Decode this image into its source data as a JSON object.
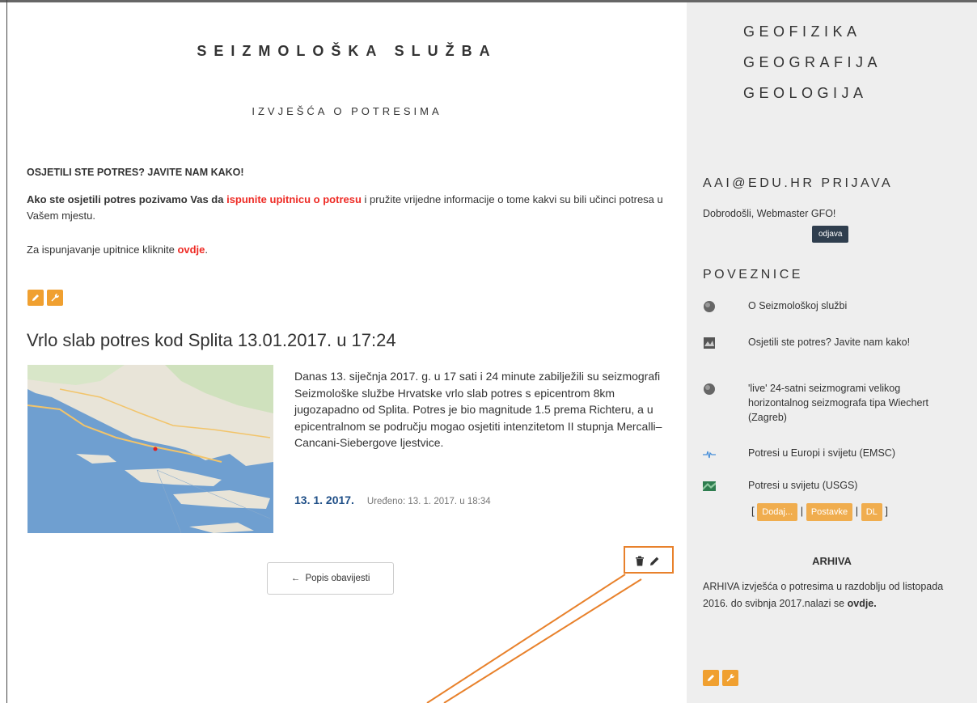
{
  "main": {
    "site_title": "SEIZMOLOŠKA SLUŽBA",
    "section_title": "IZVJEŠĆA O POTRESIMA",
    "felt": {
      "heading": "OSJETILI STE POTRES? JAVITE NAM KAKO!",
      "text_a": "Ako ste osjetili potres pozivamo Vas da ",
      "text_link": "ispunite upitnicu o potresu",
      "text_b": " i pružite vrijedne informacije o tome kakvi su bili učinci potresa u Vašem mjestu.",
      "text2_a": "Za ispunjavanje upitnice kliknite ",
      "text2_link": "ovdje",
      "text2_b": "."
    },
    "article": {
      "title": "Vrlo slab potres kod Splita 13.01.2017. u 17:24",
      "body": "Danas 13. siječnja 2017. g. u 17 sati i 24 minute zabilježili su seizmografi Seizmološke službe Hrvatske vrlo slab potres s epicentrom 8km jugozapadno od Splita. Potres je bio magnitude 1.5 prema Richteru, a u epicentralnom se području mogao osjetiti intenzitetom II stupnja Mercalli–Cancani-Siebergove ljestvice.",
      "date": "13. 1. 2017.",
      "edited": "Uređeno: 13. 1. 2017. u 18:34"
    },
    "back_button": "Popis obavijesti"
  },
  "sidebar": {
    "departments": [
      "GEOFIZIKA",
      "GEOGRAFIJA",
      "GEOLOGIJA"
    ],
    "login_heading": "AAI@EDU.HR PRIJAVA",
    "welcome": "Dobrodošli, Webmaster GFO!",
    "logout": "odjava",
    "links_heading": "POVEZNICE",
    "links": [
      {
        "label": "O Seizmološkoj službi",
        "icon": "globe-icon"
      },
      {
        "label": "Osjetili ste potres? Javite nam kako!",
        "icon": "image-icon"
      },
      {
        "label": "'live' 24-satni seizmogrami velikog horizontalnog seizmografa tipa Wiechert (Zagreb)",
        "icon": "globe-icon"
      },
      {
        "label": "Potresi u Europi i svijetu (EMSC)",
        "icon": "seismogram-icon"
      },
      {
        "label": "Potresi u svijetu (USGS)",
        "icon": "usgs-icon"
      }
    ],
    "link_controls": {
      "open": "[",
      "sep": "|",
      "close": "]",
      "add": "Dodaj...",
      "settings": "Postavke",
      "dl": "DL"
    },
    "archive_heading": "ARHIVA",
    "archive_text_a": "ARHIVA izvješća o potresima u razdoblju od listopada 2016. do svibnja 2017.nalazi se ",
    "archive_link": "ovdje",
    "archive_text_b": "."
  },
  "colors": {
    "accent_orange": "#f0a030",
    "link_red": "#ee2a24",
    "date_blue": "#1f4f87",
    "sidebar_bg": "#eeeeee",
    "annotation": "#e8812b"
  }
}
